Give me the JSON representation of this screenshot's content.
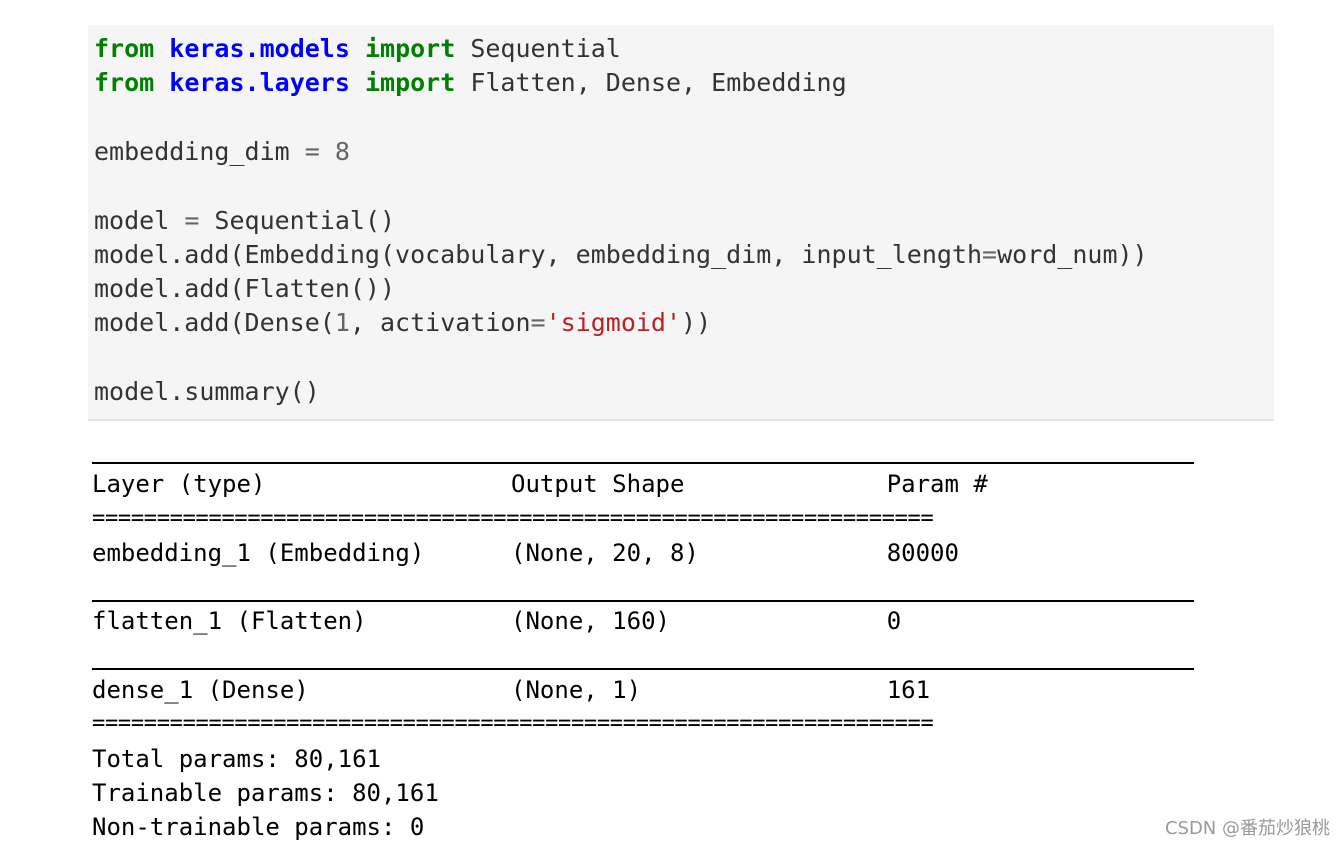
{
  "code_cell": {
    "lines": [
      {
        "tokens": [
          {
            "t": "from",
            "c": "kw"
          },
          {
            "t": " ",
            "c": ""
          },
          {
            "t": "keras.models",
            "c": "mod"
          },
          {
            "t": " ",
            "c": ""
          },
          {
            "t": "import",
            "c": "kw"
          },
          {
            "t": " Sequential",
            "c": ""
          }
        ]
      },
      {
        "tokens": [
          {
            "t": "from",
            "c": "kw"
          },
          {
            "t": " ",
            "c": ""
          },
          {
            "t": "keras.layers",
            "c": "mod"
          },
          {
            "t": " ",
            "c": ""
          },
          {
            "t": "import",
            "c": "kw"
          },
          {
            "t": " Flatten, Dense, Embedding",
            "c": ""
          }
        ]
      },
      {
        "tokens": []
      },
      {
        "tokens": [
          {
            "t": "embedding_dim ",
            "c": ""
          },
          {
            "t": "=",
            "c": "op"
          },
          {
            "t": " ",
            "c": ""
          },
          {
            "t": "8",
            "c": "num"
          }
        ]
      },
      {
        "tokens": []
      },
      {
        "tokens": [
          {
            "t": "model ",
            "c": ""
          },
          {
            "t": "=",
            "c": "op"
          },
          {
            "t": " Sequential()",
            "c": ""
          }
        ]
      },
      {
        "tokens": [
          {
            "t": "model.add(Embedding(vocabulary, embedding_dim, input_length",
            "c": ""
          },
          {
            "t": "=",
            "c": "op"
          },
          {
            "t": "word_num))",
            "c": ""
          }
        ]
      },
      {
        "tokens": [
          {
            "t": "model.add(Flatten())",
            "c": ""
          }
        ]
      },
      {
        "tokens": [
          {
            "t": "model.add(Dense(",
            "c": ""
          },
          {
            "t": "1",
            "c": "num"
          },
          {
            "t": ", activation",
            "c": ""
          },
          {
            "t": "=",
            "c": "op"
          },
          {
            "t": "'sigmoid'",
            "c": "str"
          },
          {
            "t": "))",
            "c": ""
          }
        ]
      },
      {
        "tokens": []
      },
      {
        "tokens": [
          {
            "t": "model.summary()",
            "c": ""
          }
        ]
      }
    ]
  },
  "output": {
    "header": "Layer (type)                 Output Shape              Param #",
    "separator": "=================================================================",
    "rows": [
      "embedding_1 (Embedding)      (None, 20, 8)             80000",
      "flatten_1 (Flatten)          (None, 160)               0",
      "dense_1 (Dense)              (None, 1)                 161"
    ],
    "total_params": "Total params: 80,161",
    "trainable_params": "Trainable params: 80,161",
    "non_trainable_params": "Non-trainable params: 0"
  },
  "watermark": "CSDN @番茄炒狼桃",
  "colors": {
    "keyword": "#008000",
    "module": "#0000ff",
    "string": "#ba2121",
    "operator": "#666666",
    "cell_background": "#f5f5f5"
  }
}
